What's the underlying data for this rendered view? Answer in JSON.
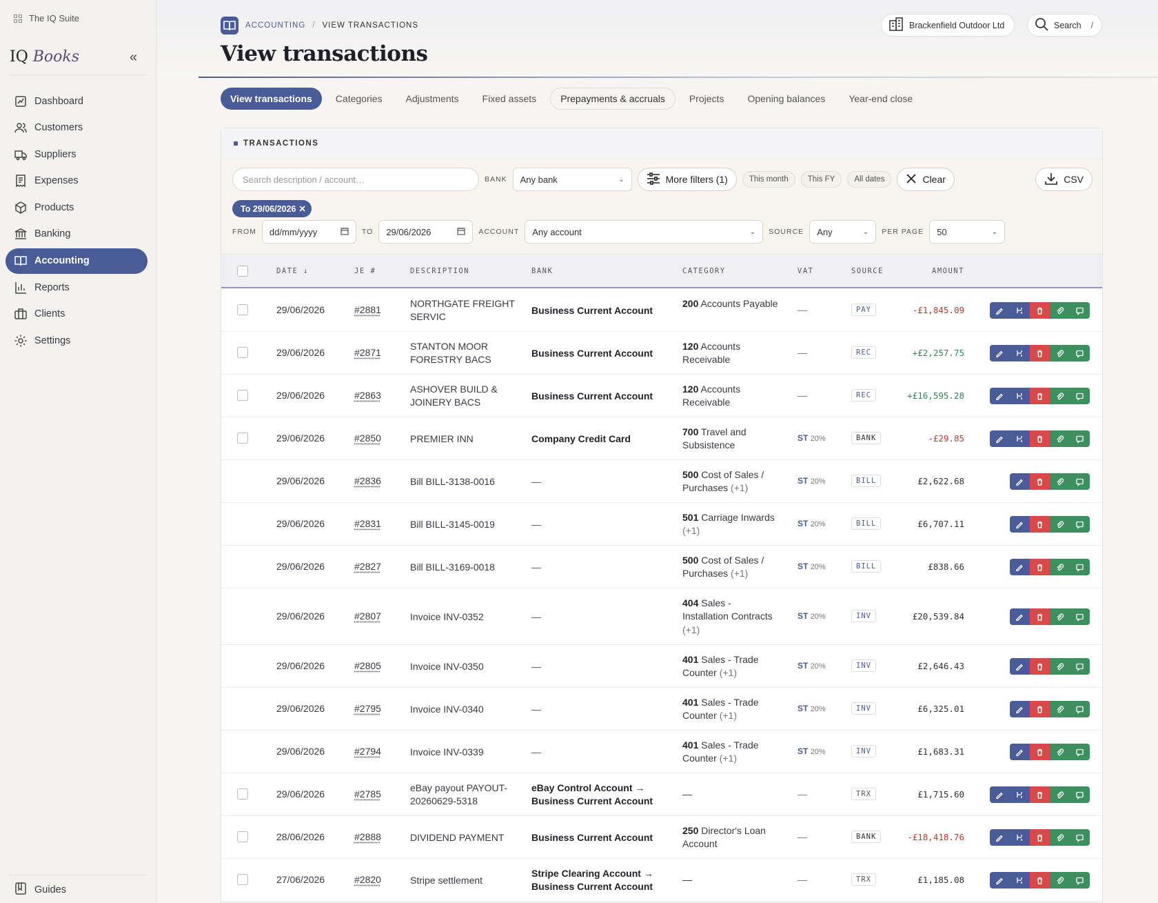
{
  "suite": {
    "label": "The IQ Suite"
  },
  "brand": {
    "part1": "IQ",
    "part2": "Books"
  },
  "sidebar": {
    "items": [
      {
        "label": "Dashboard",
        "icon": "dashboard-icon"
      },
      {
        "label": "Customers",
        "icon": "users-icon"
      },
      {
        "label": "Suppliers",
        "icon": "truck-icon"
      },
      {
        "label": "Expenses",
        "icon": "receipt-icon"
      },
      {
        "label": "Products",
        "icon": "box-icon"
      },
      {
        "label": "Banking",
        "icon": "bank-icon"
      },
      {
        "label": "Accounting",
        "icon": "book-icon",
        "active": true
      },
      {
        "label": "Reports",
        "icon": "bar-chart-icon"
      },
      {
        "label": "Clients",
        "icon": "briefcase-icon"
      },
      {
        "label": "Settings",
        "icon": "gear-icon"
      }
    ],
    "guides_label": "Guides"
  },
  "header": {
    "breadcrumb": {
      "section": "ACCOUNTING",
      "separator": "/",
      "page": "VIEW TRANSACTIONS"
    },
    "title": "View transactions",
    "company": "Brackenfield Outdoor Ltd",
    "search_label": "Search",
    "search_shortcut": "/"
  },
  "tabs": [
    {
      "label": "View transactions",
      "active": true
    },
    {
      "label": "Categories"
    },
    {
      "label": "Adjustments"
    },
    {
      "label": "Fixed assets"
    },
    {
      "label": "Prepayments & accruals",
      "outlined": true
    },
    {
      "label": "Projects"
    },
    {
      "label": "Opening balances"
    },
    {
      "label": "Year-end close"
    }
  ],
  "panel": {
    "title": "TRANSACTIONS"
  },
  "filters": {
    "search_placeholder": "Search description / account…",
    "bank_label": "BANK",
    "bank_value": "Any bank",
    "more_filters": "More filters (1)",
    "quick": [
      "This month",
      "This FY",
      "All dates"
    ],
    "clear": "Clear",
    "csv": "CSV",
    "active_chip": "To 29/06/2026",
    "from_label": "FROM",
    "from_value": "dd/mm/yyyy",
    "to_label": "TO",
    "to_value": "29/06/2026",
    "account_label": "ACCOUNT",
    "account_value": "Any account",
    "source_label": "SOURCE",
    "source_value": "Any",
    "perpage_label": "PER PAGE",
    "perpage_value": "50"
  },
  "table": {
    "columns": {
      "date": "DATE ↓",
      "je": "JE #",
      "description": "DESCRIPTION",
      "bank": "BANK",
      "category": "CATEGORY",
      "vat": "VAT",
      "source": "SOURCE",
      "amount": "AMOUNT"
    },
    "rows": [
      {
        "selectable": true,
        "date": "29/06/2026",
        "je": "#2881",
        "desc": "NORTHGATE FREIGHT SERVIC",
        "bank": "Business Current Account",
        "cat_code": "200",
        "cat_name": "Accounts Payable",
        "cat_extra": "",
        "vat_code": "",
        "vat_pct": "",
        "vat_text": "—",
        "source": "PAY",
        "amount": "-£1,845.09",
        "amount_type": "neg",
        "split": true,
        "height": 62
      },
      {
        "selectable": true,
        "date": "29/06/2026",
        "je": "#2871",
        "desc": "STANTON MOOR FORESTRY BACS",
        "bank": "Business Current Account",
        "cat_code": "120",
        "cat_name": "Accounts Receivable",
        "cat_extra": "",
        "vat_code": "",
        "vat_pct": "",
        "vat_text": "—",
        "source": "REC",
        "amount": "+£2,257.75",
        "amount_type": "pos",
        "split": true,
        "height": 62
      },
      {
        "selectable": true,
        "date": "29/06/2026",
        "je": "#2863",
        "desc": "ASHOVER BUILD & JOINERY BACS",
        "bank": "Business Current Account",
        "cat_code": "120",
        "cat_name": "Accounts Receivable",
        "cat_extra": "",
        "vat_code": "",
        "vat_pct": "",
        "vat_text": "—",
        "source": "REC",
        "amount": "+£16,595.28",
        "amount_type": "pos",
        "split": true,
        "height": 62
      },
      {
        "selectable": true,
        "date": "29/06/2026",
        "je": "#2850",
        "desc": "PREMIER INN",
        "bank": "Company Credit Card",
        "cat_code": "700",
        "cat_name": "Travel and Subsistence",
        "cat_extra": "",
        "vat_code": "ST",
        "vat_pct": "20%",
        "vat_text": "",
        "source": "BANK",
        "amount": "-£29.85",
        "amount_type": "neg",
        "split": true,
        "height": 62
      },
      {
        "selectable": false,
        "date": "29/06/2026",
        "je": "#2836",
        "desc": "Bill BILL-3138-0016",
        "bank": "—",
        "cat_code": "500",
        "cat_name": "Cost of Sales / Purchases",
        "cat_extra": "(+1)",
        "vat_code": "ST",
        "vat_pct": "20%",
        "vat_text": "",
        "source": "BILL",
        "amount": "£2,622.68",
        "amount_type": "neu",
        "split": false,
        "height": 62
      },
      {
        "selectable": false,
        "date": "29/06/2026",
        "je": "#2831",
        "desc": "Bill BILL-3145-0019",
        "bank": "—",
        "cat_code": "501",
        "cat_name": "Carriage Inwards",
        "cat_extra": "(+1)",
        "vat_code": "ST",
        "vat_pct": "20%",
        "vat_text": "",
        "source": "BILL",
        "amount": "£6,707.11",
        "amount_type": "neu",
        "split": false,
        "height": 62
      },
      {
        "selectable": false,
        "date": "29/06/2026",
        "je": "#2827",
        "desc": "Bill BILL-3169-0018",
        "bank": "—",
        "cat_code": "500",
        "cat_name": "Cost of Sales / Purchases",
        "cat_extra": "(+1)",
        "vat_code": "ST",
        "vat_pct": "20%",
        "vat_text": "",
        "source": "BILL",
        "amount": "£838.66",
        "amount_type": "neu",
        "split": false,
        "height": 62
      },
      {
        "selectable": false,
        "date": "29/06/2026",
        "je": "#2807",
        "desc": "Invoice INV-0352",
        "bank": "—",
        "cat_code": "404",
        "cat_name": "Sales - Installation Contracts",
        "cat_extra": "(+1)",
        "vat_code": "ST",
        "vat_pct": "20%",
        "vat_text": "",
        "source": "INV",
        "amount": "£20,539.84",
        "amount_type": "neu",
        "split": false,
        "height": 82
      },
      {
        "selectable": false,
        "date": "29/06/2026",
        "je": "#2805",
        "desc": "Invoice INV-0350",
        "bank": "—",
        "cat_code": "401",
        "cat_name": "Sales - Trade Counter",
        "cat_extra": "(+1)",
        "vat_code": "ST",
        "vat_pct": "20%",
        "vat_text": "",
        "source": "INV",
        "amount": "£2,646.43",
        "amount_type": "neu",
        "split": false,
        "height": 62
      },
      {
        "selectable": false,
        "date": "29/06/2026",
        "je": "#2795",
        "desc": "Invoice INV-0340",
        "bank": "—",
        "cat_code": "401",
        "cat_name": "Sales - Trade Counter",
        "cat_extra": "(+1)",
        "vat_code": "ST",
        "vat_pct": "20%",
        "vat_text": "",
        "source": "INV",
        "amount": "£6,325.01",
        "amount_type": "neu",
        "split": false,
        "height": 62
      },
      {
        "selectable": false,
        "date": "29/06/2026",
        "je": "#2794",
        "desc": "Invoice INV-0339",
        "bank": "—",
        "cat_code": "401",
        "cat_name": "Sales - Trade Counter",
        "cat_extra": "(+1)",
        "vat_code": "ST",
        "vat_pct": "20%",
        "vat_text": "",
        "source": "INV",
        "amount": "£1,683.31",
        "amount_type": "neu",
        "split": false,
        "height": 62
      },
      {
        "selectable": true,
        "date": "29/06/2026",
        "je": "#2785",
        "desc": "eBay payout PAYOUT-20260629-5318",
        "bank": "eBay Control Account → Business Current Account",
        "cat_code": "",
        "cat_name": "—",
        "cat_extra": "",
        "vat_code": "",
        "vat_pct": "",
        "vat_text": "—",
        "source": "TRX",
        "amount": "£1,715.60",
        "amount_type": "neu",
        "split": true,
        "height": 62
      },
      {
        "selectable": true,
        "date": "28/06/2026",
        "je": "#2888",
        "desc": "DIVIDEND PAYMENT",
        "bank": "Business Current Account",
        "cat_code": "250",
        "cat_name": "Director's Loan Account",
        "cat_extra": "",
        "vat_code": "",
        "vat_pct": "",
        "vat_text": "—",
        "source": "BANK",
        "amount": "-£18,418.76",
        "amount_type": "neg",
        "split": true,
        "height": 62
      },
      {
        "selectable": true,
        "date": "27/06/2026",
        "je": "#2820",
        "desc": "Stripe settlement",
        "bank": "Stripe Clearing Account → Business Current Account",
        "cat_code": "",
        "cat_name": "—",
        "cat_extra": "",
        "vat_code": "",
        "vat_pct": "",
        "vat_text": "—",
        "source": "TRX",
        "amount": "£1,185.08",
        "amount_type": "neu",
        "split": true,
        "height": 62
      }
    ]
  },
  "colors": {
    "accent": "#4a5c97",
    "danger": "#d84a4a",
    "success": "#3c8f5e"
  }
}
